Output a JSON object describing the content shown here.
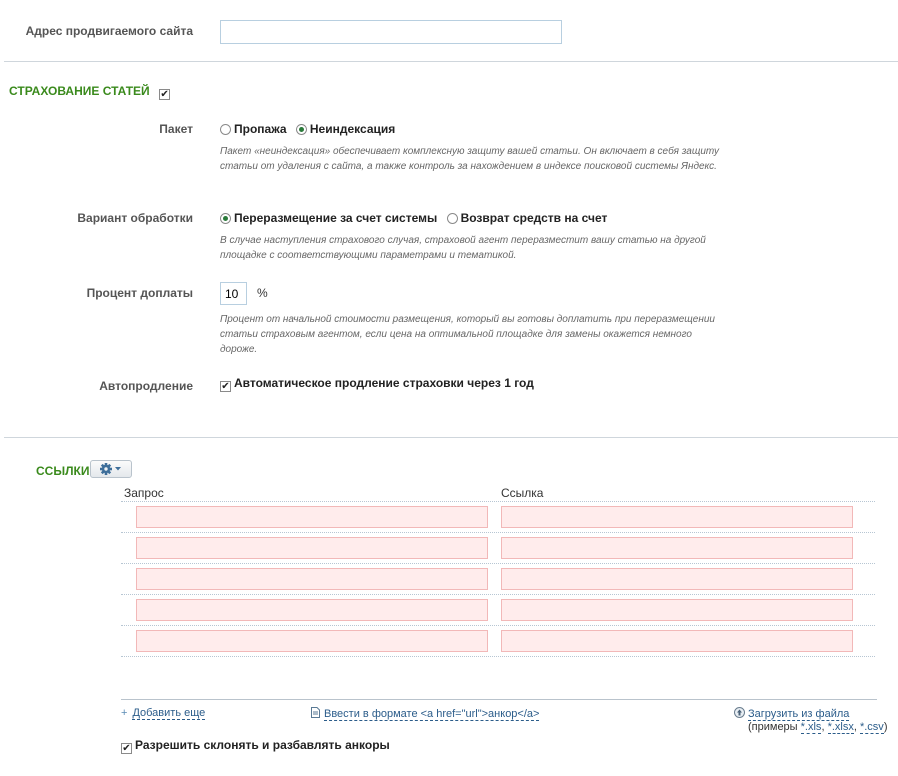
{
  "site": {
    "label": "Адрес продвигаемого сайта",
    "value": "",
    "placeholder": ""
  },
  "insurance": {
    "title": "СТРАХОВАНИЕ СТАТЕЙ",
    "enabled": true,
    "package": {
      "label": "Пакет",
      "options": [
        "Пропажа",
        "Неиндексация"
      ],
      "selected": "Неиндексация",
      "hint": "Пакет «неиндексация» обеспечивает комплексную защиту вашей статьи. Он включает в себя защиту статьи от удаления с сайта, а также контроль за нахождением в индексе поисковой системы Яндекс."
    },
    "processing": {
      "label": "Вариант обработки",
      "options": [
        "Переразмещение за счет системы",
        "Возврат средств на счет"
      ],
      "selected": "Переразмещение за счет системы",
      "hint": "В случае наступления страхового случая, страховой агент переразместит вашу статью на другой площадке с соответствующими параметрами и тематикой."
    },
    "surcharge": {
      "label": "Процент доплаты",
      "value": "10",
      "unit": "%",
      "hint": "Процент от начальной стоимости размещения, который вы готовы доплатить при переразмещении статьи страховым агентом, если цена на оптимальной площадке для замены окажется немного дороже."
    },
    "autorenew": {
      "label": "Автопродление",
      "checkbox_label": "Автоматическое продление страховки через 1 год",
      "checked": true
    }
  },
  "links": {
    "title": "ССЫЛКИ",
    "col_query": "Запрос",
    "col_link": "Ссылка",
    "rows": [
      {
        "query": "",
        "link": ""
      },
      {
        "query": "",
        "link": ""
      },
      {
        "query": "",
        "link": ""
      },
      {
        "query": "",
        "link": ""
      },
      {
        "query": "",
        "link": ""
      }
    ],
    "add_more": "Добавить еще",
    "html_format": "Ввести в формате <a href=\"url\">анкор</a>",
    "upload": "Загрузить из файла",
    "examples_prefix": "(примеры ",
    "ex_xls": "*.xls",
    "ex_xlsx": "*.xlsx",
    "ex_csv": "*.csv",
    "examples_suffix": ")",
    "sep": ", ",
    "anchors_label": "Разрешить склонять и разбавлять анкоры",
    "anchors_checked": true
  },
  "colors": {
    "section_title": "#3a8a1c",
    "link": "#2b5c8a",
    "error_bg": "#ffecec",
    "error_border": "#f2b8b8"
  }
}
